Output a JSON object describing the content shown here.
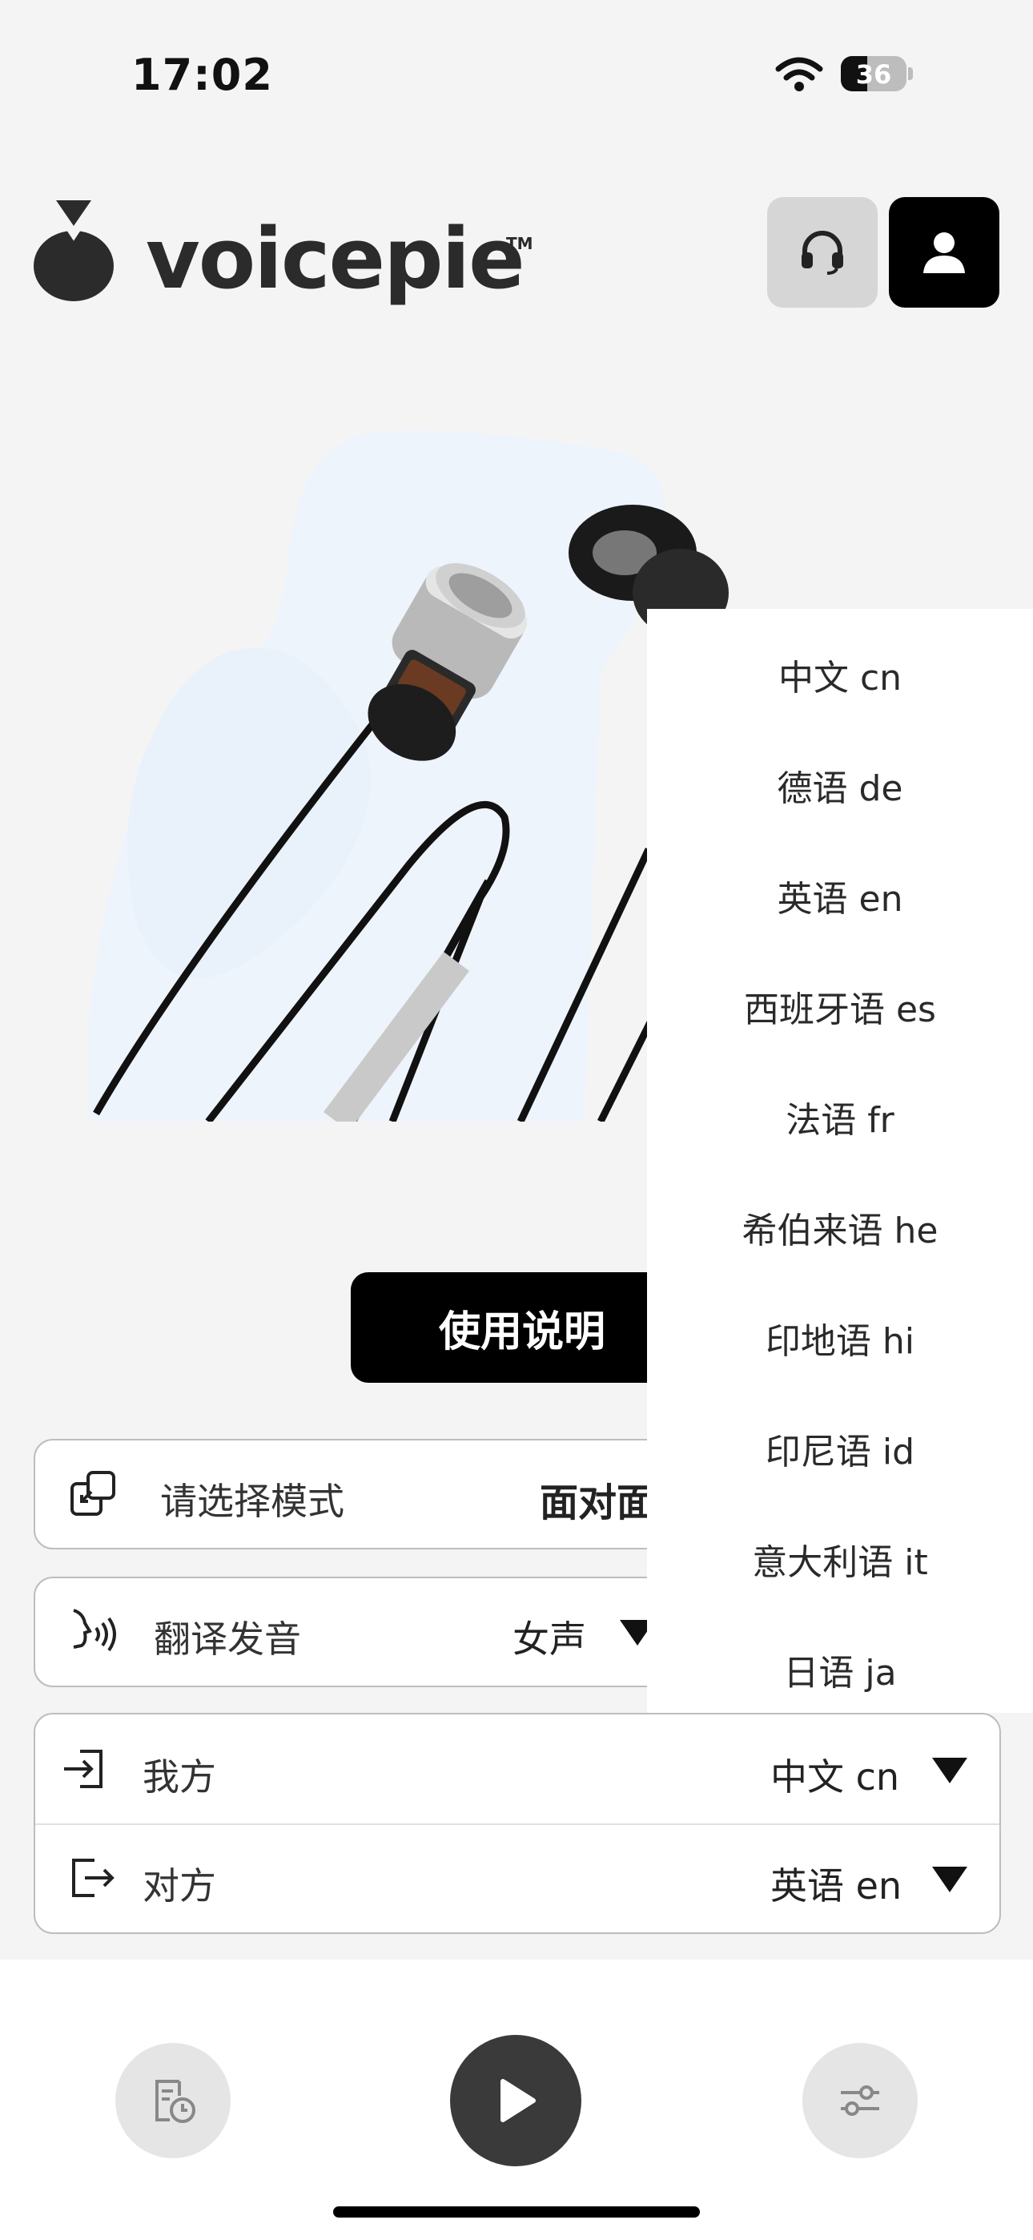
{
  "status": {
    "time": "17:02",
    "battery": "36"
  },
  "header": {
    "brand": "voicepie",
    "trademark": "TM"
  },
  "hero": {
    "image": "earphones-product-photo"
  },
  "instructions_label": "使用说明",
  "mode": {
    "label": "请选择模式",
    "value": "面对面"
  },
  "voice": {
    "label": "翻译发音",
    "value": "女声"
  },
  "languages": {
    "mine_label": "我方",
    "mine_value": "中文 cn",
    "other_label": "对方",
    "other_value": "英语 en"
  },
  "dropdown": {
    "items": [
      "中文 cn",
      "德语 de",
      "英语 en",
      "西班牙语 es",
      "法语 fr",
      "希伯来语 he",
      "印地语 hi",
      "印尼语 id",
      "意大利语 it",
      "日语 ja"
    ]
  },
  "icons": {
    "support": "headset-icon",
    "profile": "user-icon",
    "mode": "mode-switch-icon",
    "voice": "speaking-head-icon",
    "mine": "login-arrow-icon",
    "other": "logout-arrow-icon",
    "history": "history-doc-icon",
    "play": "play-icon",
    "settings": "sliders-icon"
  },
  "colors": {
    "primary": "#000000",
    "background": "#f4f4f4",
    "card": "#ffffff"
  }
}
